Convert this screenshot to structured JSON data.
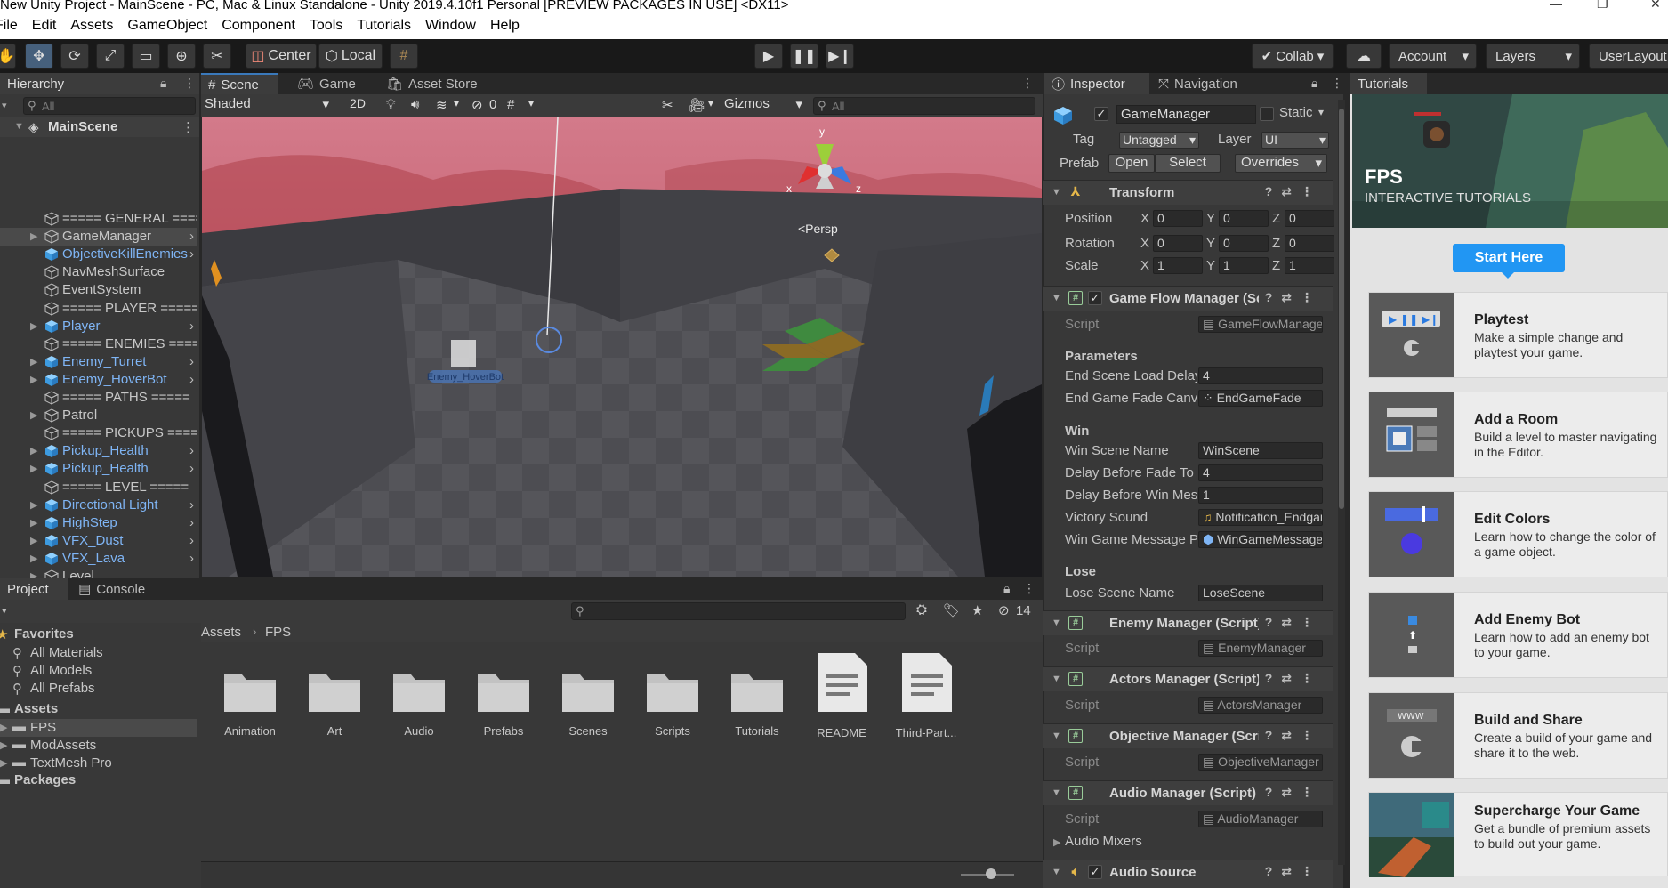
{
  "window": {
    "title": "New Unity Project - MainScene - PC, Mac & Linux Standalone - Unity 2019.4.10f1 Personal [PREVIEW PACKAGES IN USE] <DX11>"
  },
  "menu": [
    "File",
    "Edit",
    "Assets",
    "GameObject",
    "Component",
    "Tools",
    "Tutorials",
    "Window",
    "Help"
  ],
  "toolbar": {
    "pivot": "Center",
    "space": "Local",
    "collab": "Collab",
    "account": "Account",
    "layers": "Layers",
    "layout": "UserLayout"
  },
  "hierarchy": {
    "tab": "Hierarchy",
    "search_placeholder": "All",
    "scene_name": "MainScene",
    "items": [
      {
        "label": "===== GENERAL =====",
        "prefab": false,
        "expandable": false,
        "selected": false
      },
      {
        "label": "GameManager",
        "prefab": false,
        "expandable": true,
        "selected": true
      },
      {
        "label": "ObjectiveKillEnemies",
        "prefab": true,
        "expandable": false,
        "selected": false
      },
      {
        "label": "NavMeshSurface",
        "prefab": false,
        "expandable": false,
        "selected": false
      },
      {
        "label": "EventSystem",
        "prefab": false,
        "expandable": false,
        "selected": false
      },
      {
        "label": "===== PLAYER =====",
        "prefab": false,
        "expandable": false,
        "selected": false
      },
      {
        "label": "Player",
        "prefab": true,
        "expandable": true,
        "selected": false
      },
      {
        "label": "===== ENEMIES =====",
        "prefab": false,
        "expandable": false,
        "selected": false
      },
      {
        "label": "Enemy_Turret",
        "prefab": true,
        "expandable": true,
        "selected": false
      },
      {
        "label": "Enemy_HoverBot",
        "prefab": true,
        "expandable": true,
        "selected": false
      },
      {
        "label": "===== PATHS =====",
        "prefab": false,
        "expandable": false,
        "selected": false
      },
      {
        "label": "Patrol",
        "prefab": false,
        "expandable": true,
        "selected": false
      },
      {
        "label": "===== PICKUPS =====",
        "prefab": false,
        "expandable": false,
        "selected": false
      },
      {
        "label": "Pickup_Health",
        "prefab": true,
        "expandable": true,
        "selected": false
      },
      {
        "label": "Pickup_Health",
        "prefab": true,
        "expandable": true,
        "selected": false
      },
      {
        "label": "===== LEVEL =====",
        "prefab": false,
        "expandable": false,
        "selected": false
      },
      {
        "label": "Directional Light",
        "prefab": true,
        "expandable": true,
        "selected": false
      },
      {
        "label": "HighStep",
        "prefab": true,
        "expandable": true,
        "selected": false
      },
      {
        "label": "VFX_Dust",
        "prefab": true,
        "expandable": true,
        "selected": false
      },
      {
        "label": "VFX_Lava",
        "prefab": true,
        "expandable": true,
        "selected": false
      },
      {
        "label": "Level",
        "prefab": false,
        "expandable": true,
        "selected": false
      }
    ]
  },
  "scene": {
    "tabs": [
      "Scene",
      "Game",
      "Asset Store"
    ],
    "shading": "Shaded",
    "mode_2d": "2D",
    "hidden_count": "0",
    "gizmos": "Gizmos",
    "search_placeholder": "All",
    "persp": "<Persp",
    "axis_x": "x",
    "axis_y": "y",
    "axis_z": "z",
    "enemy_label": "Enemy_HoverBot"
  },
  "inspector": {
    "tabs": [
      "Inspector",
      "Navigation"
    ],
    "object_name": "GameManager",
    "static_label": "Static",
    "tag_label": "Tag",
    "tag_value": "Untagged",
    "layer_label": "Layer",
    "layer_value": "UI",
    "prefab_label": "Prefab",
    "open": "Open",
    "select": "Select",
    "overrides": "Overrides",
    "transform": {
      "title": "Transform",
      "rows": [
        {
          "label": "Position",
          "x": "0",
          "y": "0",
          "z": "0"
        },
        {
          "label": "Rotation",
          "x": "0",
          "y": "0",
          "z": "0"
        },
        {
          "label": "Scale",
          "x": "1",
          "y": "1",
          "z": "1"
        }
      ]
    },
    "gfm": {
      "title": "Game Flow Manager (Script)",
      "script_label": "Script",
      "script_value": "GameFlowManager",
      "params_header": "Parameters",
      "end_load_label": "End Scene Load Delay",
      "end_load_value": "4",
      "fade_label": "End Game Fade Canvas",
      "fade_value": "EndGameFade",
      "win_header": "Win",
      "win_scene_label": "Win Scene Name",
      "win_scene_value": "WinScene",
      "delay_fade_label": "Delay Before Fade To Black",
      "delay_fade_value": "4",
      "delay_msg_label": "Delay Before Win Message",
      "delay_msg_value": "1",
      "victory_label": "Victory Sound",
      "victory_value": "Notification_Endgame",
      "win_msg_label": "Win Game Message Prefab",
      "win_msg_value": "WinGameMessage",
      "lose_header": "Lose",
      "lose_scene_label": "Lose Scene Name",
      "lose_scene_value": "LoseScene"
    },
    "enemy_manager": {
      "title": "Enemy Manager (Script)",
      "script_label": "Script",
      "script_value": "EnemyManager"
    },
    "actors_manager": {
      "title": "Actors Manager (Script)",
      "script_label": "Script",
      "script_value": "ActorsManager"
    },
    "objective_manager": {
      "title": "Objective Manager (Script)",
      "script_label": "Script",
      "script_value": "ObjectiveManager"
    },
    "audio_manager": {
      "title": "Audio Manager (Script)",
      "script_label": "Script",
      "script_value": "AudioManager",
      "mixers": "Audio Mixers"
    },
    "audio_source": {
      "title": "Audio Source"
    }
  },
  "tutorials": {
    "tab": "Tutorials",
    "banner_title": "FPS",
    "banner_subtitle": "INTERACTIVE TUTORIALS",
    "start_button": "Start Here",
    "cards": [
      {
        "title": "Playtest",
        "desc": "Make a simple change and playtest your game."
      },
      {
        "title": "Add a Room",
        "desc": "Build a level to master navigating in the Editor."
      },
      {
        "title": "Edit Colors",
        "desc": "Learn how to change the color of a game object."
      },
      {
        "title": "Add Enemy Bot",
        "desc": "Learn how to add an enemy bot to your game."
      },
      {
        "title": "Build and Share",
        "desc": "Create a build of your game and share it to the web."
      },
      {
        "title": "Supercharge Your Game",
        "desc": "Get a bundle of premium assets to build out your game."
      }
    ],
    "www_label": "WWW"
  },
  "project": {
    "tabs": [
      "Project",
      "Console"
    ],
    "hidden_count": "14",
    "favorites_label": "Favorites",
    "favorites": [
      "All Materials",
      "All Models",
      "All Prefabs"
    ],
    "assets_label": "Assets",
    "asset_folders": [
      "FPS",
      "ModAssets",
      "TextMesh Pro"
    ],
    "packages_label": "Packages",
    "breadcrumb": [
      "Assets",
      "FPS"
    ],
    "items": [
      {
        "name": "Animation",
        "kind": "folder"
      },
      {
        "name": "Art",
        "kind": "folder"
      },
      {
        "name": "Audio",
        "kind": "folder"
      },
      {
        "name": "Prefabs",
        "kind": "folder"
      },
      {
        "name": "Scenes",
        "kind": "folder"
      },
      {
        "name": "Scripts",
        "kind": "folder"
      },
      {
        "name": "Tutorials",
        "kind": "folder"
      },
      {
        "name": "README",
        "kind": "file"
      },
      {
        "name": "Third-Part...",
        "kind": "file"
      }
    ]
  },
  "colors": {
    "selection": "#46607c",
    "prefab_text": "#7fb5f5",
    "accent_blue": "#3a79bb",
    "tutorial_button": "#2196f3"
  }
}
